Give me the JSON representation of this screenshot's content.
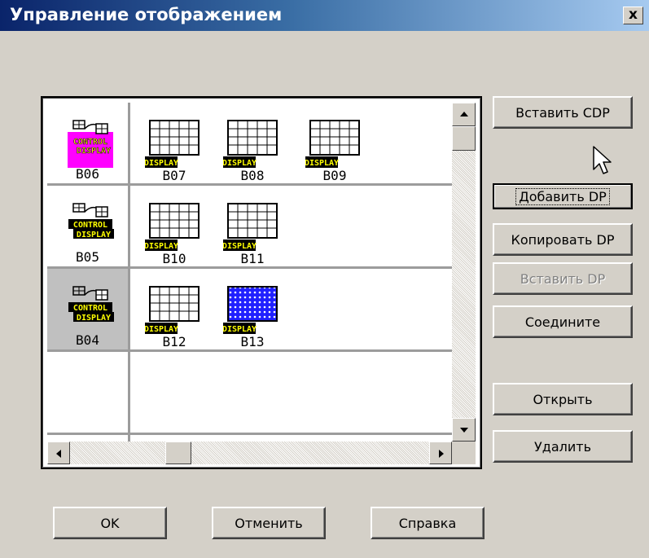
{
  "window": {
    "title": "Управление отображением",
    "close_label": "x"
  },
  "grid": {
    "rows": [
      {
        "cd": {
          "label": "B06",
          "selected": false,
          "highlight": true
        },
        "displays": [
          {
            "label": "B07",
            "active": false
          },
          {
            "label": "B08",
            "active": false
          },
          {
            "label": "B09",
            "active": false
          }
        ]
      },
      {
        "cd": {
          "label": "B05",
          "selected": false,
          "highlight": false
        },
        "displays": [
          {
            "label": "B10",
            "active": false
          },
          {
            "label": "B11",
            "active": false
          }
        ]
      },
      {
        "cd": {
          "label": "B04",
          "selected": true,
          "highlight": false
        },
        "displays": [
          {
            "label": "B12",
            "active": false
          },
          {
            "label": "B13",
            "active": true
          }
        ]
      },
      {
        "cd": null,
        "displays": []
      }
    ],
    "icon_text": {
      "control": "CONTROL",
      "display": "DISPLAY"
    }
  },
  "side_buttons": {
    "insert_cdp": "Вставить CDP",
    "add_dp": "Добавить DP",
    "copy_dp": "Копировать DP",
    "paste_dp": "Вставить DP",
    "connect": "Соедините",
    "open": "Открыть",
    "delete": "Удалить"
  },
  "bottom_buttons": {
    "ok": "OK",
    "cancel": "Отменить",
    "help": "Справка"
  },
  "colors": {
    "title_start": "#0a246a",
    "title_end": "#a6caf0",
    "cd_highlight": "#ff00ff",
    "display_label_bg": "#ffff00",
    "display_active": "#2020ff",
    "face": "#d4d0c8"
  }
}
